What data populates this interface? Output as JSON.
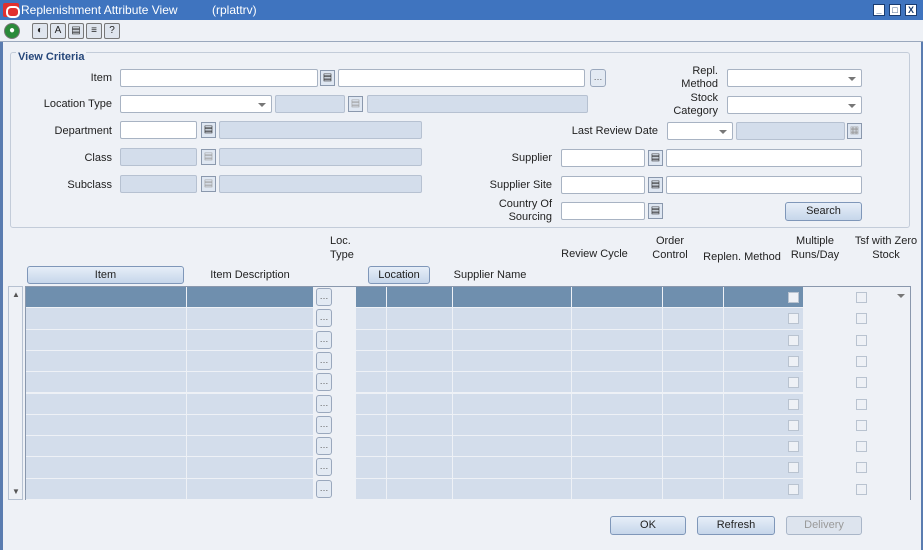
{
  "window": {
    "title": "Replenishment Attribute View",
    "form_code": "(rplattrv)",
    "controls": [
      "_",
      "□",
      "X"
    ]
  },
  "toolbar": {
    "icons": [
      "globe-icon",
      "refresh-icon",
      "spell-check-icon",
      "clipboard-icon",
      "print-icon",
      "help-icon"
    ]
  },
  "criteria": {
    "legend": "View Criteria",
    "item": "Item",
    "location_type": "Location Type",
    "department": "Department",
    "class": "Class",
    "subclass": "Subclass",
    "repl_method": "Repl. Method",
    "stock_category": "Stock Category",
    "last_review_date": "Last Review Date",
    "supplier": "Supplier",
    "supplier_site": "Supplier Site",
    "country_of_sourcing": "Country Of Sourcing",
    "search": "Search"
  },
  "table": {
    "headers": {
      "item": "Item",
      "item_description": "Item Description",
      "loc_type": "Loc. Type",
      "location": "Location",
      "supplier_name": "Supplier Name",
      "review_cycle": "Review Cycle",
      "order_control": "Order Control",
      "replen_method": "Replen. Method",
      "multiple_runs": "Multiple Runs/Day",
      "tsf_zero": "Tsf with Zero Stock"
    },
    "row_count": 10
  },
  "buttons": {
    "ok": "OK",
    "refresh": "Refresh",
    "delivery": "Delivery"
  }
}
